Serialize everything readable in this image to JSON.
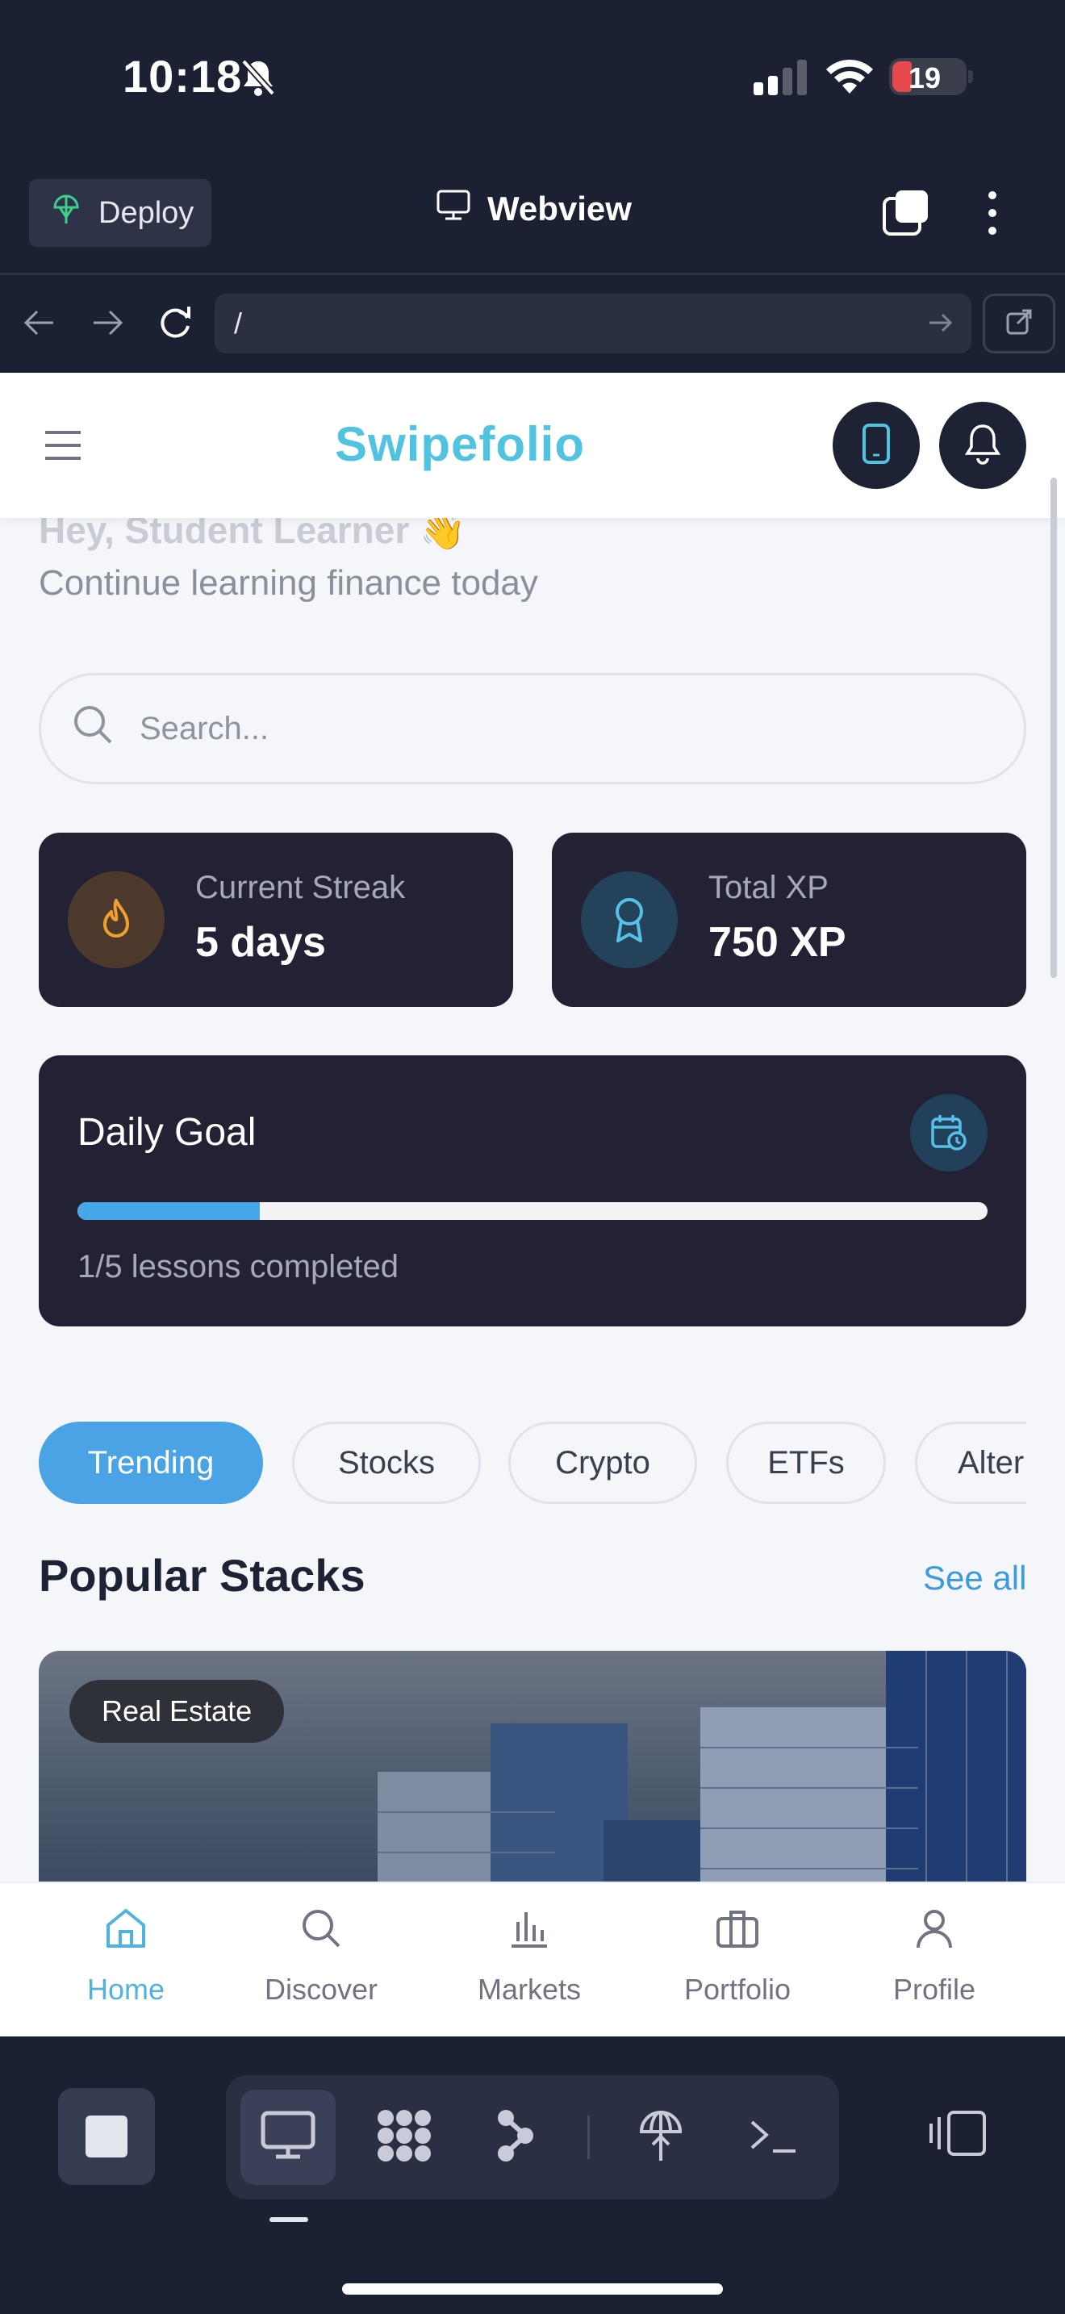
{
  "status_bar": {
    "time": "10:18",
    "battery": "19"
  },
  "toolbar": {
    "deploy_label": "Deploy",
    "webview_label": "Webview"
  },
  "url_bar": {
    "value": "/"
  },
  "header": {
    "brand": "Swipefolio"
  },
  "hero": {
    "greeting_partial": "Hey, Student Learner 👋",
    "subtitle": "Continue learning finance today"
  },
  "search": {
    "placeholder": "Search..."
  },
  "stats": {
    "streak": {
      "label": "Current Streak",
      "value": "5 days"
    },
    "xp": {
      "label": "Total XP",
      "value": "750 XP"
    }
  },
  "daily_goal": {
    "title": "Daily Goal",
    "progress_fraction": 0.2,
    "text": "1/5 lessons completed"
  },
  "categories": [
    "Trending",
    "Stocks",
    "Crypto",
    "ETFs",
    "Alternatives"
  ],
  "popular": {
    "title": "Popular Stacks",
    "see_all": "See all",
    "card_badge": "Real Estate"
  },
  "bottom_nav": [
    "Home",
    "Discover",
    "Markets",
    "Portfolio",
    "Profile"
  ],
  "colors": {
    "brand": "#4fc3e0",
    "accent": "#4aa3e4",
    "card_dark": "#232234",
    "streak_orange": "#f0a030"
  }
}
